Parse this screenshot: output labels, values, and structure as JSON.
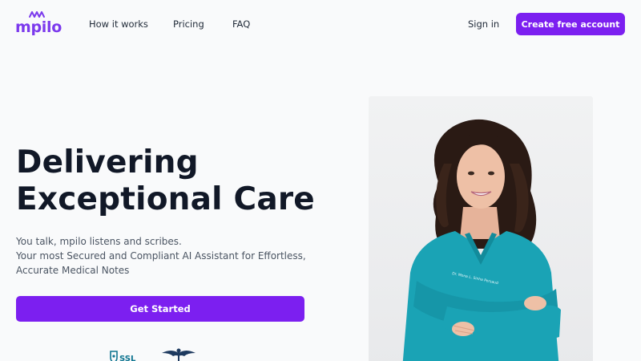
{
  "brand": {
    "name": "mpilo",
    "color": "#7c3aed"
  },
  "nav": {
    "links": [
      "How it works",
      "Pricing",
      "FAQ"
    ],
    "sign_in": "Sign in",
    "create_account": "Create free account"
  },
  "hero": {
    "title_line1": "Delivering",
    "title_line2": "Exceptional Care",
    "subtitle_line1": "You talk, mpilo listens and scribes.",
    "subtitle_line2": "Your most Secured and Compliant AI Assistant for Effortless,",
    "subtitle_line3": "Accurate Medical Notes",
    "cta": "Get Started"
  },
  "badges": {
    "ssl_text": "SSL"
  },
  "photo": {
    "badge_text": "Dr. Mona L. Sinha Persaud"
  },
  "colors": {
    "accent": "#7c1ff0",
    "background": "#f9fafb",
    "scrubs": "#1aa3b5"
  }
}
